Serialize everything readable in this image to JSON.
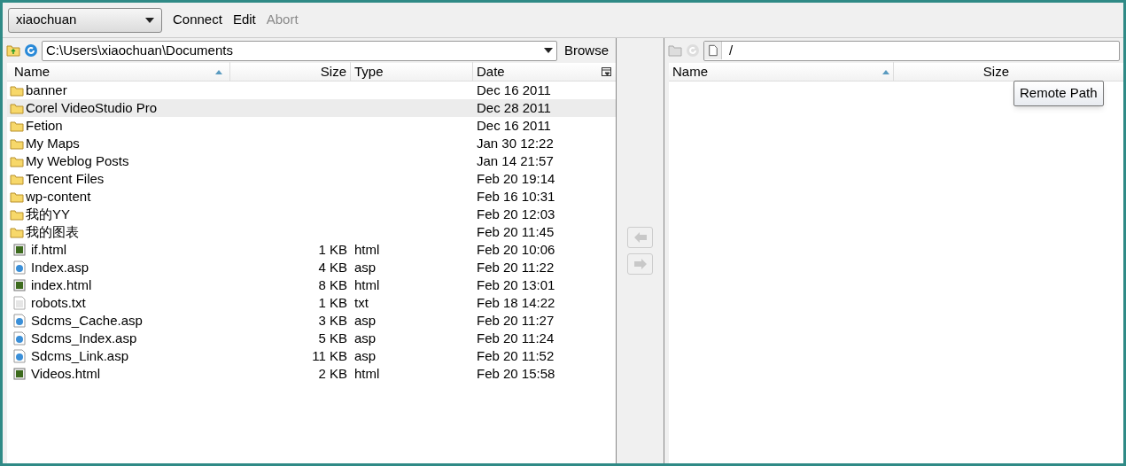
{
  "toolbar": {
    "site": "xiaochuan",
    "actions": [
      {
        "label": "Connect",
        "disabled": false
      },
      {
        "label": "Edit",
        "disabled": false
      },
      {
        "label": "Abort",
        "disabled": true
      }
    ]
  },
  "local": {
    "path": "C:\\Users\\xiaochuan\\Documents",
    "browse": "Browse",
    "columns": [
      "Name",
      "Size",
      "Type",
      "Date"
    ],
    "rows": [
      {
        "kind": "folder",
        "name": "banner",
        "date": "Dec 16 2011",
        "selected": false
      },
      {
        "kind": "folder",
        "name": "Corel VideoStudio Pro",
        "date": "Dec 28 2011",
        "selected": true
      },
      {
        "kind": "folder",
        "name": "Fetion",
        "date": "Dec 16 2011",
        "selected": false
      },
      {
        "kind": "folder",
        "name": "My Maps",
        "date": "Jan 30 12:22",
        "selected": false
      },
      {
        "kind": "folder",
        "name": "My Weblog Posts",
        "date": "Jan 14 21:57",
        "selected": false
      },
      {
        "kind": "folder",
        "name": "Tencent Files",
        "date": "Feb 20 19:14",
        "selected": false
      },
      {
        "kind": "folder",
        "name": "wp-content",
        "date": "Feb 16 10:31",
        "selected": false
      },
      {
        "kind": "folder",
        "name": "我的YY",
        "date": "Feb 20 12:03",
        "selected": false
      },
      {
        "kind": "folder",
        "name": "我的图表",
        "date": "Feb 20 11:45",
        "selected": false
      },
      {
        "kind": "html",
        "name": "if.html",
        "size": "1 KB",
        "type": "html",
        "date": "Feb 20 10:06",
        "selected": false
      },
      {
        "kind": "asp",
        "name": "Index.asp",
        "size": "4 KB",
        "type": "asp",
        "date": "Feb 20 11:22",
        "selected": false
      },
      {
        "kind": "html",
        "name": "index.html",
        "size": "8 KB",
        "type": "html",
        "date": "Feb 20 13:01",
        "selected": false
      },
      {
        "kind": "txt",
        "name": "robots.txt",
        "size": "1 KB",
        "type": "txt",
        "date": "Feb 18 14:22",
        "selected": false
      },
      {
        "kind": "asp",
        "name": "Sdcms_Cache.asp",
        "size": "3 KB",
        "type": "asp",
        "date": "Feb 20 11:27",
        "selected": false
      },
      {
        "kind": "asp",
        "name": "Sdcms_Index.asp",
        "size": "5 KB",
        "type": "asp",
        "date": "Feb 20 11:24",
        "selected": false
      },
      {
        "kind": "asp",
        "name": "Sdcms_Link.asp",
        "size": "11 KB",
        "type": "asp",
        "date": "Feb 20 11:52",
        "selected": false
      },
      {
        "kind": "html",
        "name": "Videos.html",
        "size": "2 KB",
        "type": "html",
        "date": "Feb 20 15:58",
        "selected": false
      }
    ]
  },
  "remote": {
    "path": "/",
    "columns": [
      "Name",
      "Size"
    ],
    "tooltip": "Remote Path"
  }
}
